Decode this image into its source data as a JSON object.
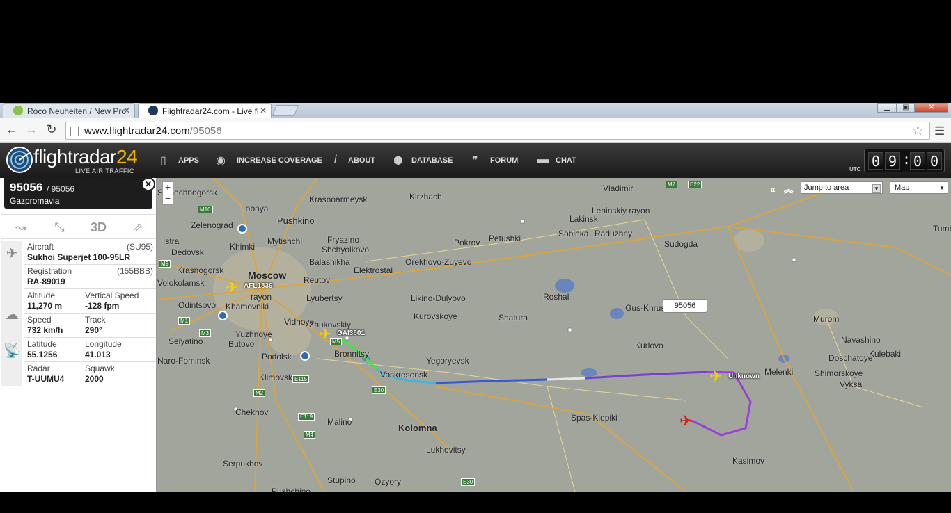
{
  "browser": {
    "tabs": [
      {
        "label": "Roco Neuheiten / New Pro",
        "active": false
      },
      {
        "label": "Flightradar24.com - Live fl",
        "active": true
      }
    ],
    "url_domain": "www.flightradar24.com",
    "url_path": "/95056"
  },
  "header": {
    "logo_main": "flightradar",
    "logo_num": "24",
    "logo_sub": "LIVE AIR TRAFFIC",
    "nav": [
      "APPS",
      "INCREASE COVERAGE",
      "ABOUT",
      "DATABASE",
      "FORUM",
      "CHAT"
    ],
    "utc_label": "UTC",
    "clock": {
      "h1": "0",
      "h2": "9",
      "m1": "0",
      "m2": "0"
    }
  },
  "flight": {
    "callsign": "95056",
    "flight_no": "/ 95056",
    "airline": "Gazpromavia",
    "action_3d": "3D",
    "aircraft_label": "Aircraft",
    "aircraft_code": "(SU95)",
    "aircraft": "Sukhoi Superjet 100-95LR",
    "registration_label": "Registration",
    "registration_code": "(155BBB)",
    "registration": "RA-89019",
    "altitude_label": "Altitude",
    "altitude": "11,270 m",
    "vspeed_label": "Vertical Speed",
    "vspeed": "-128 fpm",
    "speed_label": "Speed",
    "speed": "732 km/h",
    "track_label": "Track",
    "track": "290°",
    "lat_label": "Latitude",
    "lat": "55.1256",
    "lon_label": "Longitude",
    "lon": "41.013",
    "radar_label": "Radar",
    "radar": "T-UUMU4",
    "squawk_label": "Squawk",
    "squawk": "2000"
  },
  "map": {
    "jump_label": "Jump to area",
    "map_type": "Map",
    "zoom_in": "+",
    "zoom_out": "−",
    "callout": "95056",
    "planes": [
      "AFL1839",
      "GAI3601",
      "Unknown"
    ],
    "cities": [
      "Vladimir",
      "Solnechnogorsk",
      "Lobnya",
      "Pushkino",
      "Krasnoarmeysk",
      "Kirzhach",
      "Lakinsk",
      "Leninskiy rayon",
      "Zelenograd",
      "Khimki",
      "Istra",
      "Mytishchi",
      "Fryazino",
      "Shchyolkovo",
      "Pokrov",
      "Petushki",
      "Sobinka",
      "Raduzhny",
      "Sudogda",
      "Dedovsk",
      "Krasnogorsk",
      "Moscow",
      "Balashikha",
      "Elektrostal",
      "Orekhovo-Zuyevo",
      "Reutov",
      "Volokolamsk",
      "Odintsovo",
      "Khamovniki",
      "rayon",
      "Lyubertsy",
      "Likino-Dulyovo",
      "Roshal",
      "Gus-Khrustalny",
      "Murom",
      "Yuzhnoye",
      "Butovo",
      "Vidnoye",
      "Zhukovskiy",
      "Kurovskoye",
      "Shatura",
      "Navashino",
      "Selyatino",
      "Bronnitsy",
      "Kurlovo",
      "Kulebaki",
      "Podolsk",
      "Voskresensk",
      "Yegoryevsk",
      "Melenki",
      "Doschatoye",
      "Shimorskoye",
      "Klimovsk",
      "Vyksa",
      "Naro-Fominsk",
      "Chekhov",
      "Spas-Klepiki",
      "Malino",
      "Kolomna",
      "Lukhovitsy",
      "Kasimov",
      "Serpukhov",
      "Stupino",
      "Ozyory",
      "Pushchino",
      "Tumb"
    ],
    "roads": [
      "M7",
      "E22",
      "M10",
      "M9",
      "M1",
      "M3",
      "M5",
      "E30",
      "M2",
      "E115",
      "E119",
      "M4",
      "E30"
    ]
  }
}
